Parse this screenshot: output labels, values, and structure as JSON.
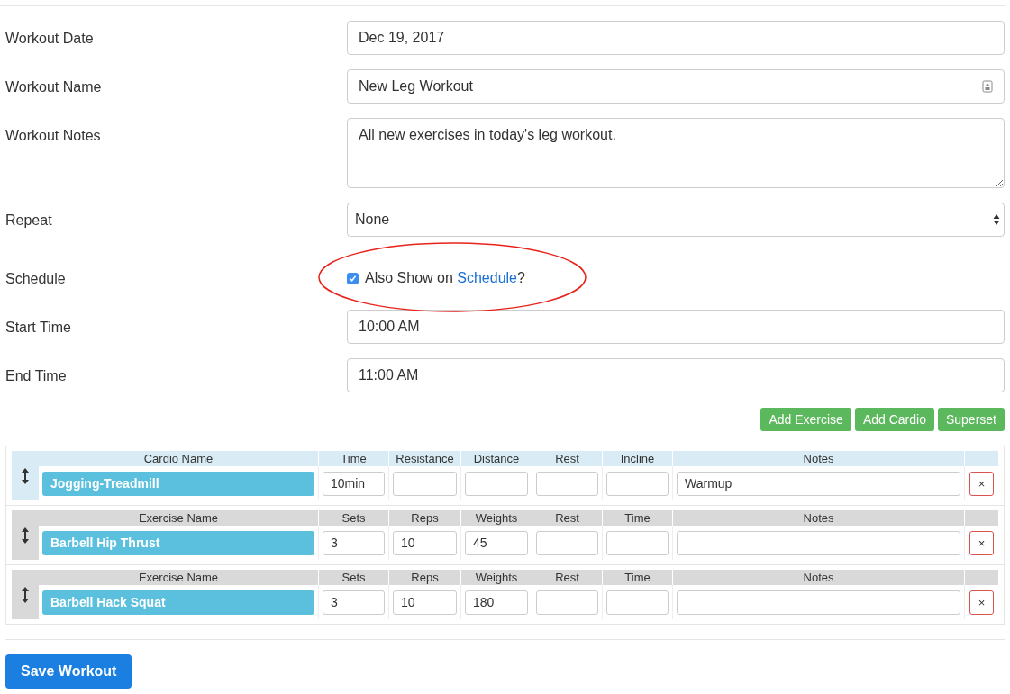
{
  "fields": [
    {
      "kind": "input",
      "label": "Workout Date",
      "value": "Dec 19, 2017"
    },
    {
      "kind": "input_icon",
      "label": "Workout Name",
      "value": "New Leg Workout"
    },
    {
      "kind": "textarea",
      "label": "Workout Notes",
      "value": "All new exercises in today's leg workout."
    },
    {
      "kind": "select",
      "label": "Repeat",
      "value": "None"
    },
    {
      "kind": "checkbox",
      "label": "Schedule",
      "checked": true,
      "text_before": "Also Show on",
      "link": "Schedule",
      "text_after": "?",
      "circled": true
    },
    {
      "kind": "input",
      "label": "Start Time",
      "value": "10:00 AM"
    },
    {
      "kind": "input",
      "label": "End Time",
      "value": "11:00 AM"
    }
  ],
  "actions": [
    "Add Exercise",
    "Add Cardio",
    "Superset"
  ],
  "entries": [
    {
      "kind": "cardio",
      "headers": [
        "Cardio Name",
        "Time",
        "Resistance",
        "Distance",
        "Rest",
        "Incline",
        "Notes"
      ],
      "name": "Jogging-Treadmill",
      "values": [
        "10min"
      ],
      "notes": "Warmup"
    },
    {
      "kind": "exercise",
      "headers": [
        "Exercise Name",
        "Sets",
        "Reps",
        "Weights",
        "Rest",
        "Time",
        "Notes"
      ],
      "name": "Barbell Hip Thrust",
      "values": [
        "3",
        "10",
        "45"
      ]
    },
    {
      "kind": "exercise",
      "headers": [
        "Exercise Name",
        "Sets",
        "Reps",
        "Weights",
        "Rest",
        "Time",
        "Notes"
      ],
      "name": "Barbell Hack Squat",
      "values": [
        "3",
        "10",
        "180"
      ]
    }
  ],
  "delete_label": "×",
  "save_label": "Save Workout"
}
